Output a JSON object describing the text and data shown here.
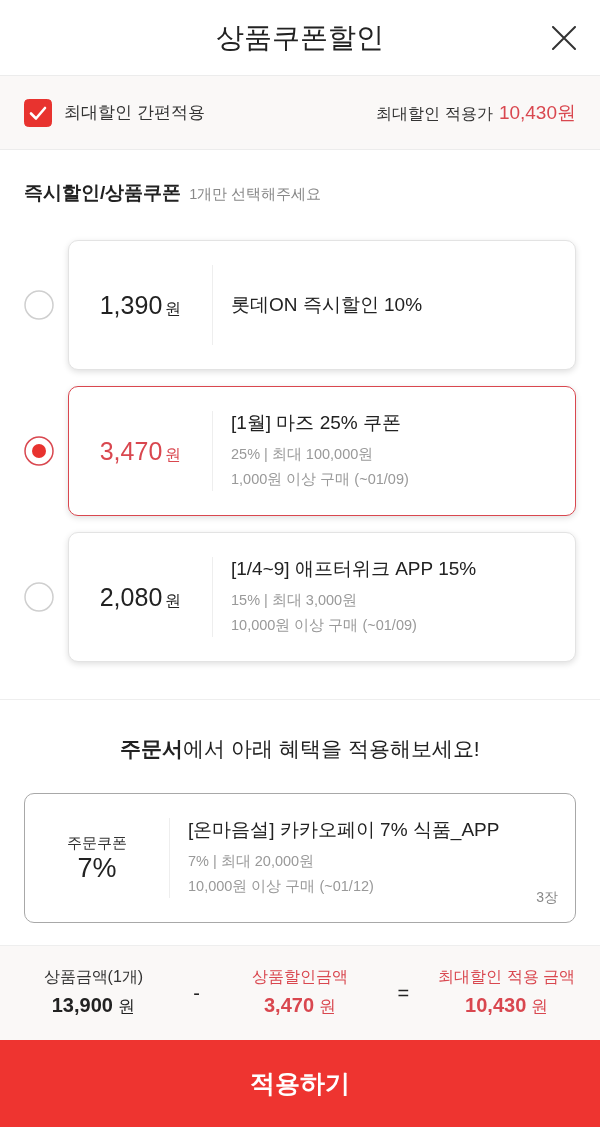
{
  "header": {
    "title": "상품쿠폰할인"
  },
  "max_discount": {
    "label": "최대할인 간편적용",
    "checked": true,
    "price_label": "최대할인 적용가",
    "price": "10,430원"
  },
  "instant_section": {
    "title": "즉시할인/상품쿠폰",
    "hint": "1개만 선택해주세요",
    "coupons": [
      {
        "amount": "1,390",
        "unit": "원",
        "title": "롯데ON 즉시할인 10%",
        "selected": false
      },
      {
        "amount": "3,470",
        "unit": "원",
        "title": "[1월] 마즈 25% 쿠폰",
        "details": [
          "25% | 최대 100,000원",
          "1,000원 이상 구매 (~01/09)"
        ],
        "selected": true
      },
      {
        "amount": "2,080",
        "unit": "원",
        "title": "[1/4~9] 애프터위크 APP 15%",
        "details": [
          "15% | 최대 3,000원",
          "10,000원 이상 구매 (~01/09)"
        ],
        "selected": false
      }
    ]
  },
  "order_section": {
    "heading": "**주문서**에서 아래 혜택을 적용해보세요!",
    "coupons": [
      {
        "type": "주문쿠폰",
        "rate": "7%",
        "title": "[온마음설] 카카오페이 7% 식품_APP",
        "details": [
          "7% | 최대 20,000원",
          "10,000원 이상 구매 (~01/12)"
        ],
        "count": "3장"
      }
    ]
  },
  "summary": {
    "columns": [
      {
        "label": "상품금액(1개)",
        "amount": "13,900",
        "unit": "원",
        "highlight": false
      },
      {
        "label": "상품할인금액",
        "amount": "3,470",
        "unit": "원",
        "highlight": true
      },
      {
        "label": "최대할인 적용 금액",
        "amount": "10,430",
        "unit": "원",
        "highlight": true
      }
    ],
    "operators": [
      "-",
      "="
    ]
  },
  "apply_button": {
    "label": "적용하기"
  }
}
